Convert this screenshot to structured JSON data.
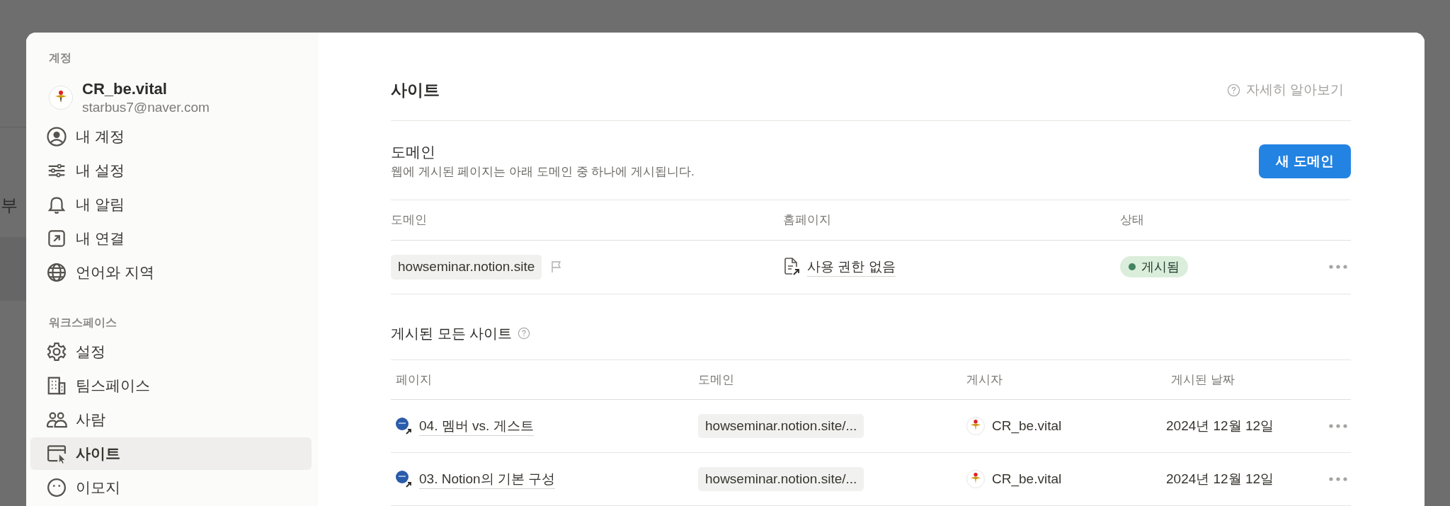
{
  "background": {
    "text": "부"
  },
  "sidebar": {
    "account_heading": "계정",
    "user": {
      "name": "CR_be.vital",
      "email": "starbus7@naver.com"
    },
    "account_items": [
      {
        "label": "내 계정",
        "selected": false
      },
      {
        "label": "내 설정",
        "selected": false
      },
      {
        "label": "내 알림",
        "selected": false
      },
      {
        "label": "내 연결",
        "selected": false
      },
      {
        "label": "언어와 지역",
        "selected": false
      }
    ],
    "workspace_heading": "워크스페이스",
    "workspace_items": [
      {
        "label": "설정",
        "selected": false
      },
      {
        "label": "팀스페이스",
        "selected": false
      },
      {
        "label": "사람",
        "selected": false
      },
      {
        "label": "사이트",
        "selected": true
      },
      {
        "label": "이모지",
        "selected": false
      }
    ]
  },
  "main": {
    "title": "사이트",
    "help_link": "자세히 알아보기",
    "domains": {
      "title": "도메인",
      "description": "웹에 게시된 페이지는 아래 도메인 중 하나에 게시됩니다.",
      "new_button": "새 도메인",
      "columns": [
        "도메인",
        "홈페이지",
        "상태"
      ],
      "rows": [
        {
          "domain": "howseminar.notion.site",
          "homepage": "사용 권한 없음",
          "status": "게시됨"
        }
      ]
    },
    "sites": {
      "title": "게시된 모든 사이트",
      "columns": [
        "페이지",
        "도메인",
        "게시자",
        "게시된 날짜"
      ],
      "rows": [
        {
          "page": "04. 멤버 vs. 게스트",
          "domain": "howseminar.notion.site/...",
          "publisher": "CR_be.vital",
          "date": "2024년 12월 12일"
        },
        {
          "page": "03. Notion의 기본 구성",
          "domain": "howseminar.notion.site/...",
          "publisher": "CR_be.vital",
          "date": "2024년 12월 12일"
        }
      ]
    }
  }
}
